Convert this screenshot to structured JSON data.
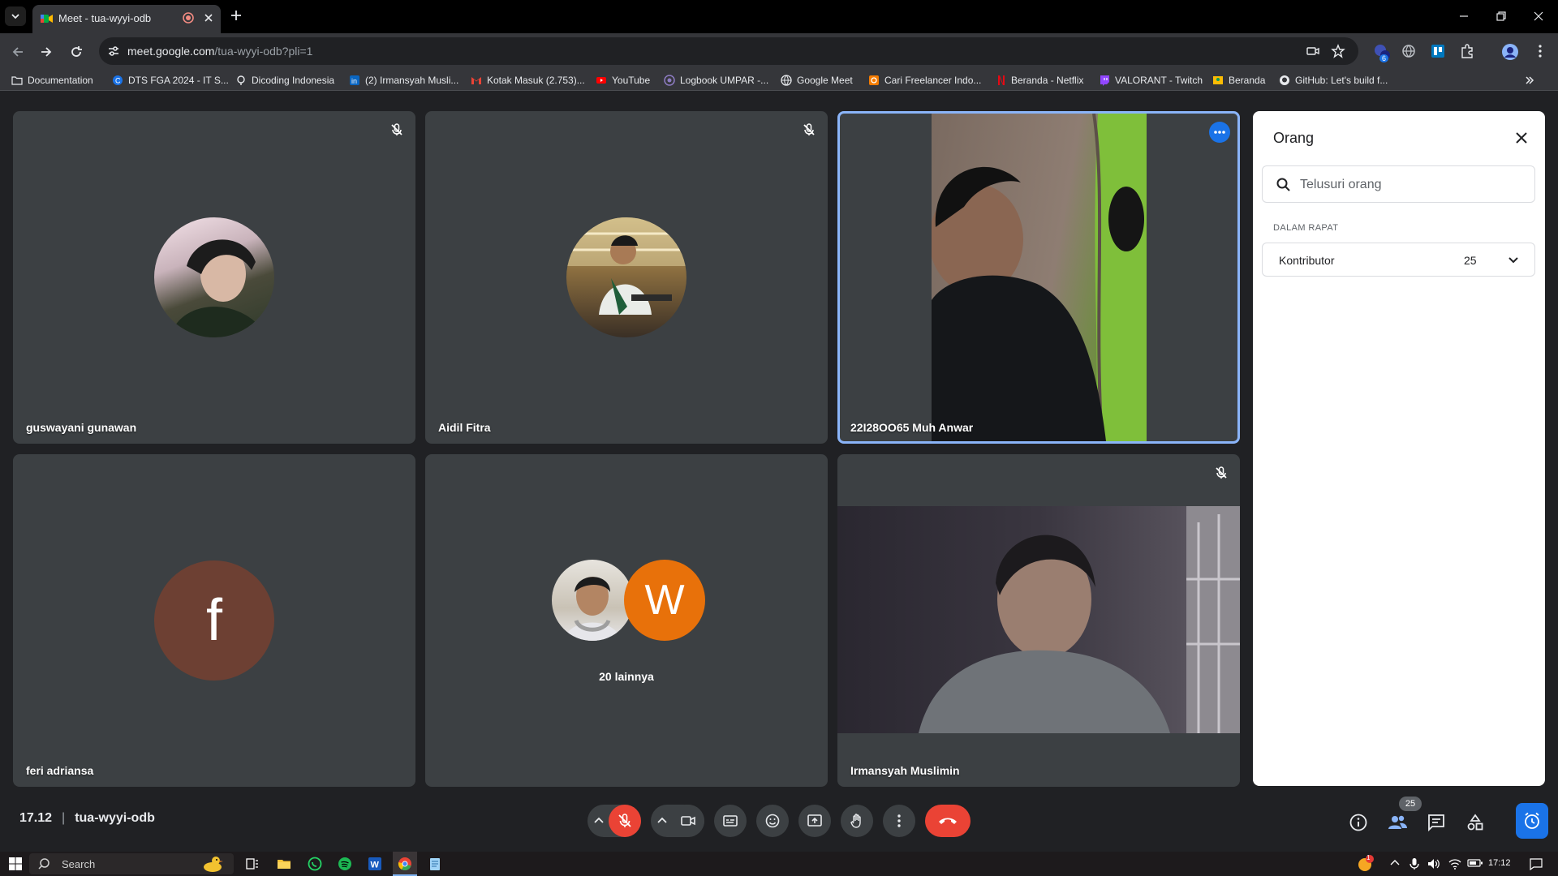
{
  "browser": {
    "tab_title": "Meet - tua-wyyi-odb",
    "url_host": "meet.google.com",
    "url_path": "/tua-wyyi-odb?pli=1",
    "extension_badge": "6"
  },
  "bookmarks": [
    "Documentation",
    "DTS FGA 2024 - IT S...",
    "Dicoding Indonesia",
    "(2) Irmansyah Musli...",
    "Kotak Masuk (2.753)...",
    "YouTube",
    "Logbook UMPAR -...",
    "Google Meet",
    "Cari Freelancer Indo...",
    "Beranda - Netflix",
    "VALORANT - Twitch",
    "Beranda",
    "GitHub: Let's build f..."
  ],
  "tiles": {
    "t1": {
      "name": "guswayani gunawan"
    },
    "t2": {
      "name": "Aidil Fitra"
    },
    "t3": {
      "name": "22I28OO65 Muh Anwar"
    },
    "t4": {
      "name": "feri adriansa",
      "initial": "f"
    },
    "t5": {
      "name": "20 lainnya",
      "initial": "W"
    },
    "t6": {
      "name": "Irmansyah Muslimin"
    }
  },
  "panel": {
    "title": "Orang",
    "search_placeholder": "Telusuri orang",
    "section": "DALAM RAPAT",
    "group_label": "Kontributor",
    "group_count": "25"
  },
  "controls": {
    "time": "17.12",
    "meeting_code": "tua-wyyi-odb",
    "people_badge": "25"
  },
  "taskbar": {
    "search_label": "Search",
    "clock": "17:12",
    "notif_badge": "1"
  },
  "colors": {
    "meet_bg": "#202124",
    "tile_bg": "#3c4043",
    "accent": "#8ab4f8",
    "end_call": "#ea4335",
    "active_blue": "#1a73e8",
    "avatar_f": "#6d4033",
    "avatar_w": "#e8710a"
  }
}
